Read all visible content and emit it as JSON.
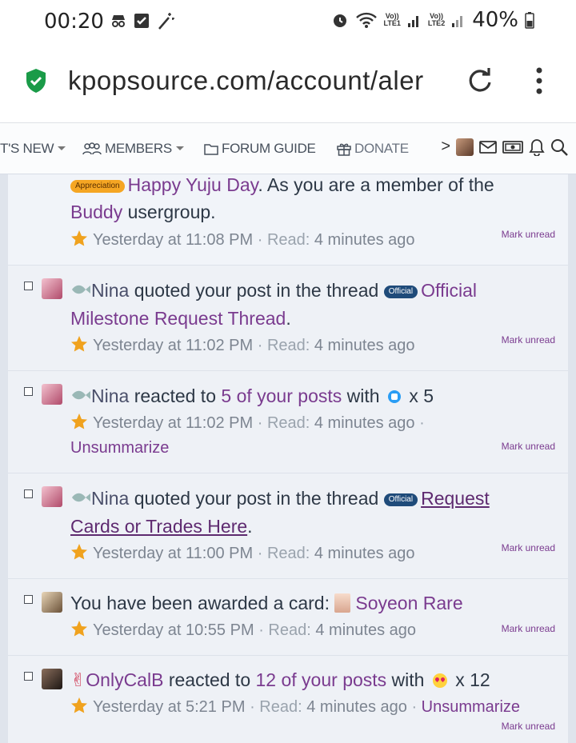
{
  "status_bar": {
    "time": "00:20",
    "battery": "40%",
    "net1_top": "Vo))",
    "net1_bottom": "LTE1",
    "net2_top": "Vo))",
    "net2_bottom": "LTE2"
  },
  "browser": {
    "url": "kpopsource.com/account/aler"
  },
  "nav": {
    "whats_new": "T'S NEW",
    "members": "MEMBERS",
    "forum_guide": "FORUM GUIDE",
    "donate": "DONATE",
    "more": ">"
  },
  "alerts": [
    {
      "badge": "Appreciation",
      "link": "Happy Yuju Day",
      "text_after": ". As you are a member of the",
      "line2_link": "Buddy",
      "line2_text": " usergroup.",
      "time": "Yesterday at 11:08 PM",
      "read_label": "Read:",
      "read_value": "4 minutes ago",
      "mark": "Mark unread"
    },
    {
      "user": "Nina",
      "text": " quoted your post in the thread ",
      "badge": "Official",
      "link": "Official",
      "line2_link": "Milestone Request Thread",
      "line2_text": ".",
      "time": "Yesterday at 11:02 PM",
      "read_label": "Read:",
      "read_value": "4 minutes ago",
      "mark": "Mark unread"
    },
    {
      "user": "Nina",
      "text": " reacted to ",
      "link": "5 of your posts",
      "text_after": " with",
      "count": "x 5",
      "time": "Yesterday at 11:02 PM",
      "read_label": "Read:",
      "read_value": "4 minutes ago",
      "extra": "Unsummarize",
      "mark": "Mark unread"
    },
    {
      "user": "Nina",
      "text": " quoted your post in the thread ",
      "badge": "Official",
      "link": "Request",
      "line2_link": "Cards or Trades Here",
      "line2_text": ".",
      "time": "Yesterday at 11:00 PM",
      "read_label": "Read:",
      "read_value": "4 minutes ago",
      "mark": "Mark unread"
    },
    {
      "text": "You have been awarded a card: ",
      "link": "Soyeon Rare",
      "time": "Yesterday at 10:55 PM",
      "read_label": "Read:",
      "read_value": "4 minutes ago",
      "mark": "Mark unread"
    },
    {
      "user": "OnlyCalB",
      "text": " reacted to ",
      "link": "12 of your posts",
      "text_after": " with",
      "count": "x 12",
      "time": "Yesterday at 5:21 PM",
      "read_label": "Read:",
      "read_value": "4 minutes ago",
      "extra": "Unsummarize",
      "mark": "Mark unread"
    }
  ],
  "colors": {
    "link": "#7a3b8f",
    "star": "#f0a21e",
    "official_badge": "#1f4b7a",
    "appreciation_badge": "#f5a623",
    "security_shield": "#1a9b48"
  }
}
